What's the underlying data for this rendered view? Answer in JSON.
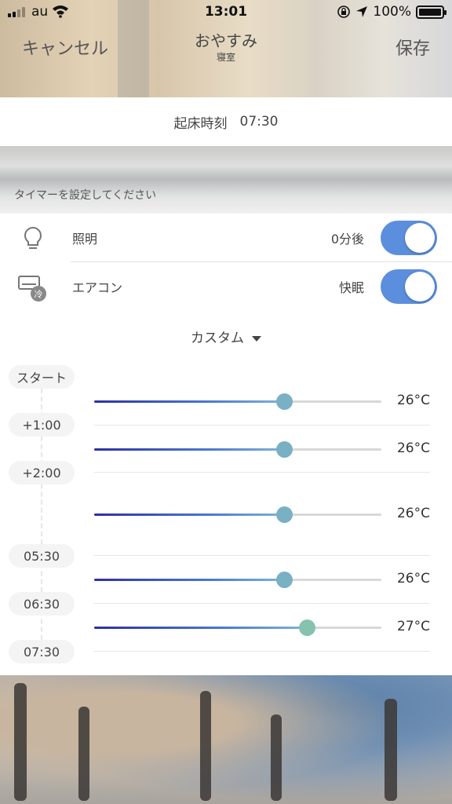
{
  "status_bar": {
    "carrier": "au",
    "time": "13:01",
    "battery": "100%"
  },
  "header": {
    "cancel_label": "キャンセル",
    "title": "おやすみ",
    "subtitle": "寝室",
    "save_label": "保存"
  },
  "wake": {
    "label": "起床時刻",
    "time": "07:30"
  },
  "timer_hint": "タイマーを設定してください",
  "devices": [
    {
      "name": "照明",
      "icon": "lightbulb-icon",
      "value": "0分後",
      "enabled": true
    },
    {
      "name": "エアコン",
      "icon": "aircon-cool-icon",
      "icon_badge": "冷",
      "value": "快眠",
      "enabled": true
    }
  ],
  "mode": {
    "label": "カスタム"
  },
  "timeline": {
    "labels": [
      "スタート",
      "+1:00",
      "+2:00",
      "05:30",
      "06:30",
      "07:30"
    ]
  },
  "schedule": [
    {
      "temperature": 26,
      "display": "26°C",
      "fraction": 0.66
    },
    {
      "temperature": 26,
      "display": "26°C",
      "fraction": 0.66
    },
    {
      "temperature": 26,
      "display": "26°C",
      "fraction": 0.66
    },
    {
      "temperature": 26,
      "display": "26°C",
      "fraction": 0.66
    },
    {
      "temperature": 27,
      "display": "27°C",
      "fraction": 0.74
    }
  ],
  "colors": {
    "toggle_on": "#5b8fdd",
    "slider_start": "#2d2fa6",
    "slider_end": "#7fb3d6",
    "thumb_26": "#7ab0c4",
    "thumb_27": "#86c2ae"
  }
}
